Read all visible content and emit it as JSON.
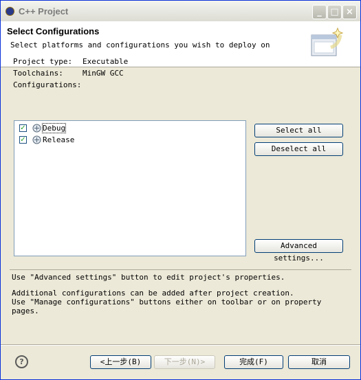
{
  "window": {
    "title": "C++ Project"
  },
  "header": {
    "title": "Select Configurations",
    "description": "Select platforms and configurations you wish to deploy on"
  },
  "info": {
    "project_type_label": "Project type:",
    "project_type_value": "Executable",
    "toolchains_label": "Toolchains:",
    "toolchains_value": "MinGW GCC",
    "configurations_label": "Configurations:"
  },
  "configurations": [
    {
      "label": "Debug",
      "checked": true
    },
    {
      "label": "Release",
      "checked": true
    }
  ],
  "buttons": {
    "select_all": "Select all",
    "deselect_all": "Deselect all",
    "advanced_settings": "Advanced settings..."
  },
  "status": {
    "line1": "Use \"Advanced settings\" button to edit project's properties.",
    "line2": "Additional configurations can be added after project creation.",
    "line3": "Use \"Manage configurations\" buttons either on toolbar or on property pages."
  },
  "footer": {
    "help_glyph": "?",
    "back": "<上一步(B)",
    "next": "下一步(N)>",
    "finish": "完成(F)",
    "cancel": "取消"
  },
  "title_buttons": {
    "minimize": "_",
    "maximize": "□",
    "close": "×"
  }
}
